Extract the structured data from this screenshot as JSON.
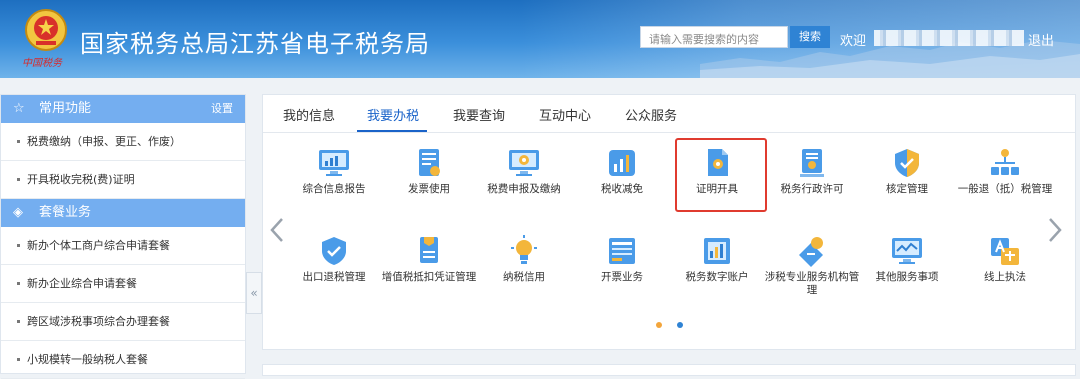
{
  "header": {
    "title": "国家税务总局江苏省电子税务局",
    "signature": "中国税务",
    "search_placeholder": "请输入需要搜索的内容",
    "search_button": "搜索",
    "welcome": "欢迎",
    "logout": "退出"
  },
  "sidebar": {
    "section1": {
      "title": "常用功能",
      "settings": "设置"
    },
    "items1": [
      {
        "label": "税费缴纳（申报、更正、作废）"
      },
      {
        "label": "开具税收完税(费)证明"
      }
    ],
    "section2": {
      "title": "套餐业务"
    },
    "items2": [
      {
        "label": "新办个体工商户综合申请套餐"
      },
      {
        "label": "新办企业综合申请套餐"
      },
      {
        "label": "跨区域涉税事项综合办理套餐"
      },
      {
        "label": "小规模转一般纳税人套餐"
      }
    ]
  },
  "tabs": [
    {
      "label": "我的信息"
    },
    {
      "label": "我要办税"
    },
    {
      "label": "我要查询"
    },
    {
      "label": "互动中心"
    },
    {
      "label": "公众服务"
    }
  ],
  "services_row1": [
    {
      "label": "综合信息报告",
      "icon": "monitor-chart-icon"
    },
    {
      "label": "发票使用",
      "icon": "invoice-icon"
    },
    {
      "label": "税费申报及缴纳",
      "icon": "monitor-gear-icon"
    },
    {
      "label": "税收减免",
      "icon": "bar-chart-icon"
    },
    {
      "label": "证明开具",
      "icon": "document-seal-icon"
    },
    {
      "label": "税务行政许可",
      "icon": "certificate-icon"
    },
    {
      "label": "核定管理",
      "icon": "shield-check-icon"
    },
    {
      "label": "一般退（抵）税管理",
      "icon": "org-tree-icon"
    }
  ],
  "services_row2": [
    {
      "label": "出口退税管理",
      "icon": "shield-check-icon"
    },
    {
      "label": "增值税抵扣凭证管理",
      "icon": "document-tag-icon"
    },
    {
      "label": "纳税信用",
      "icon": "lightbulb-icon"
    },
    {
      "label": "开票业务",
      "icon": "form-icon"
    },
    {
      "label": "税务数字账户",
      "icon": "ledger-icon"
    },
    {
      "label": "涉税专业服务机构管理",
      "icon": "badge-tag-icon"
    },
    {
      "label": "其他服务事项",
      "icon": "monitor-line-icon"
    },
    {
      "label": "线上执法",
      "icon": "translate-icon"
    }
  ],
  "colors": {
    "accent": "#1a63c9",
    "highlight": "#e03b2f",
    "sidebar_head": "#74aef0"
  }
}
